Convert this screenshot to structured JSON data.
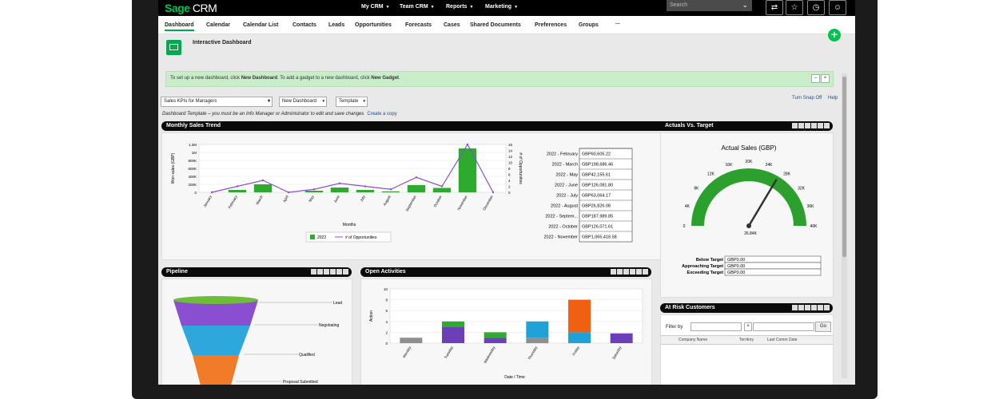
{
  "topbar": {
    "logo_brand": "Sage",
    "logo_product": "CRM",
    "menus": [
      {
        "label": "My CRM"
      },
      {
        "label": "Team CRM"
      },
      {
        "label": "Reports"
      },
      {
        "label": "Marketing"
      }
    ],
    "search_placeholder": "Search",
    "icons": [
      "recent-icon",
      "favorites-icon",
      "notifications-icon",
      "user-icon"
    ]
  },
  "tabs": [
    {
      "label": "Dashboard",
      "active": true
    },
    {
      "label": "Calendar"
    },
    {
      "label": "Calendar List"
    },
    {
      "label": "Contacts"
    },
    {
      "label": "Leads"
    },
    {
      "label": "Opportunities"
    },
    {
      "label": "Forecasts"
    },
    {
      "label": "Cases"
    },
    {
      "label": "Shared Documents"
    },
    {
      "label": "Preferences"
    },
    {
      "label": "Groups"
    },
    {
      "label": "..."
    }
  ],
  "page": {
    "title": "Interactive Dashboard",
    "info_prefix": "To set up a new dashboard, click ",
    "info_link1": "New Dashboard",
    "info_mid": ". To add a gadget to a new dashboard, click ",
    "info_link2": "New Gadget",
    "info_suffix": ".",
    "dashboard_select": "Sales KPIs for Managers",
    "new_dashboard_btn": "New Dashboard",
    "template_btn": "Template",
    "snap_link": "Turn Snap Off",
    "help_link": "Help",
    "hint_text": "Dashboard Template – you must be an Info Manager or Administrator to edit and save changes",
    "create_copy_link": "Create a copy"
  },
  "panels": {
    "monthly_sales": "Monthly Sales Trend",
    "actuals": "Actuals Vs. Target",
    "pipeline": "Pipeline",
    "open_activities": "Open Activities",
    "at_risk": "At Risk Customers"
  },
  "colors": {
    "brand_green": "#00a94f",
    "bar_green": "#2eaa2e",
    "line_purple": "#8a4fd0",
    "gauge_green": "#2ca02c"
  },
  "chart_data": [
    {
      "type": "bar",
      "panel": "Monthly Sales Trend",
      "xlabel": "Months",
      "ylabel": "Won sales (GBP)",
      "y2label": "# of Opportunities",
      "categories": [
        "January",
        "February",
        "March",
        "April",
        "May",
        "June",
        "July",
        "August",
        "September",
        "October",
        "November",
        "December"
      ],
      "y_ticks": [
        "0",
        "200K",
        "400K",
        "600K",
        "800K",
        "1M",
        "1.2M"
      ],
      "y2_ticks": [
        "0",
        "2",
        "4",
        "6",
        "8",
        "10",
        "12",
        "14",
        "16"
      ],
      "ylim": [
        0,
        1200000
      ],
      "y2lim": [
        0,
        16
      ],
      "series": [
        {
          "name": "2022",
          "type": "bar",
          "values": [
            0,
            60000,
            200000,
            0,
            40000,
            120000,
            60000,
            25000,
            180000,
            110000,
            1100000,
            0
          ]
        },
        {
          "name": "# of Opportunities",
          "type": "line",
          "values": [
            0,
            2,
            4,
            0,
            1,
            3,
            2,
            1,
            5,
            2,
            16,
            0
          ]
        }
      ],
      "table": [
        {
          "month": "2022 - February",
          "value": "GBP60,605.22"
        },
        {
          "month": "2022 - March",
          "value": "GBP198,686.46"
        },
        {
          "month": "2022 - May",
          "value": "GBP42,155.61"
        },
        {
          "month": "2022 - June",
          "value": "GBP126,081.80"
        },
        {
          "month": "2022 - July",
          "value": "GBP63,064.17"
        },
        {
          "month": "2022 - August",
          "value": "GBP26,826.08"
        },
        {
          "month": "2022 - Septem...",
          "value": "GBP187,989.85"
        },
        {
          "month": "2022 - October",
          "value": "GBP126,071.61"
        },
        {
          "month": "2022 - November",
          "value": "GBP1,065,418.58"
        }
      ]
    },
    {
      "type": "gauge",
      "panel": "Actuals Vs. Target",
      "title": "Actual Sales (GBP)",
      "ticks": [
        "0",
        "4K",
        "8K",
        "12K",
        "16K",
        "20K",
        "24K",
        "28K",
        "32K",
        "36K",
        "40K"
      ],
      "range": [
        0,
        40000
      ],
      "value": 26840,
      "value_label": "26.84K",
      "targets": [
        {
          "label": "Below Target",
          "value": "GBP0.00"
        },
        {
          "label": "Approaching Target",
          "value": "GBP0.00"
        },
        {
          "label": "Exceeding Target",
          "value": "GBP0.00"
        }
      ]
    },
    {
      "type": "funnel",
      "panel": "Pipeline",
      "stages": [
        "Lead",
        "Negotiating",
        "Qualified",
        "Proposal Submitted"
      ]
    },
    {
      "type": "bar",
      "stacked": true,
      "panel": "Open Activities",
      "xlabel": "Date / Time",
      "ylabel": "Action",
      "categories": [
        "Monday",
        "Tuesday",
        "Wednesday",
        "Thursday",
        "Friday",
        "Saturday"
      ],
      "y_ticks": [
        "0",
        "2",
        "4",
        "6",
        "8",
        "10"
      ],
      "ylim": [
        0,
        10
      ],
      "series": [
        {
          "color": "#8e8e8e",
          "values": [
            1,
            0,
            0,
            1,
            0,
            0
          ]
        },
        {
          "color": "#6a3fb8",
          "values": [
            0,
            3,
            1,
            0,
            0,
            1.8
          ]
        },
        {
          "color": "#2eaa2e",
          "values": [
            0,
            1,
            1,
            0,
            0,
            0
          ]
        },
        {
          "color": "#1fa2d8",
          "values": [
            0,
            0,
            0,
            3,
            2,
            0
          ]
        },
        {
          "color": "#f06012",
          "values": [
            0,
            0,
            0,
            0,
            6,
            0
          ]
        }
      ]
    }
  ],
  "at_risk": {
    "filter_label": "Filter by",
    "filter_value": "",
    "go_btn": "Go",
    "columns": [
      "Company Name",
      "Territory",
      "Last Comm Date"
    ]
  }
}
